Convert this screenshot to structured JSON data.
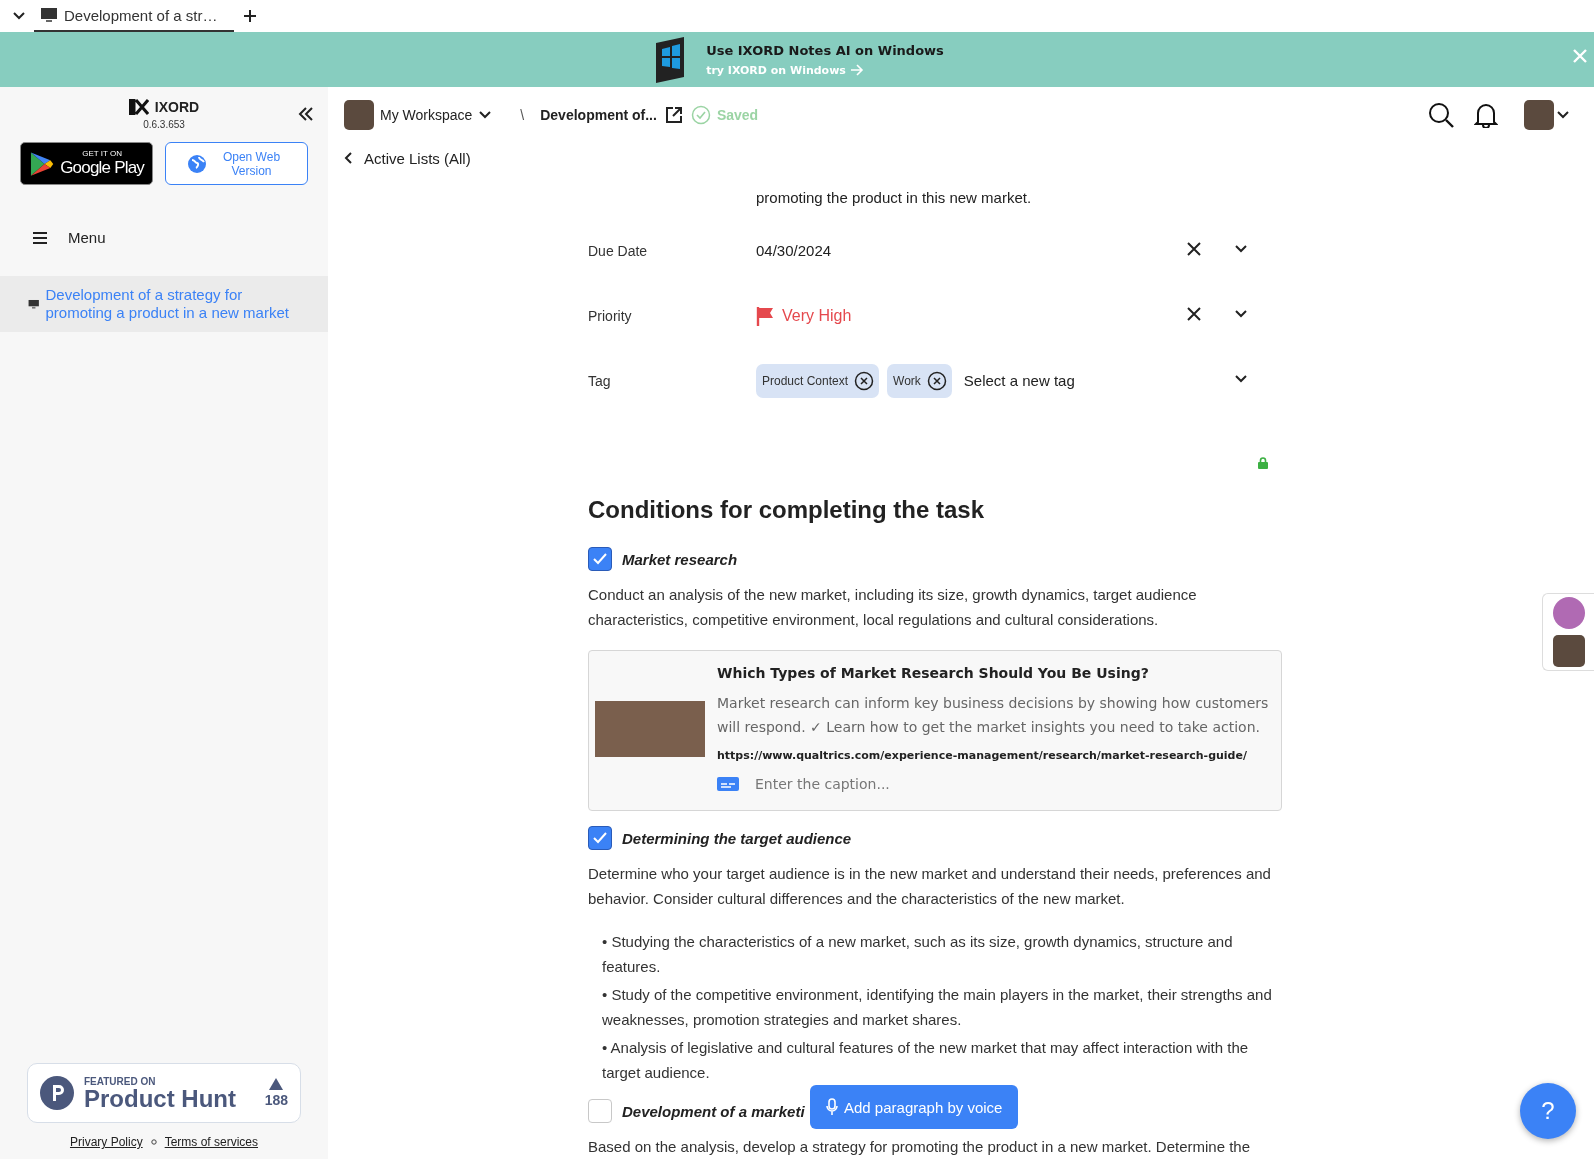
{
  "browser_tabs": [
    {
      "title": "Development of a str…",
      "selected": true
    }
  ],
  "banner": {
    "title": "Use IXORD Notes AI on Windows",
    "link": "try IXORD on Windows"
  },
  "sidebar": {
    "brand": "IXORD",
    "version": "0.6.3.653",
    "store_button": {
      "small": "GET IT ON",
      "big": "Google Play"
    },
    "web_button": "Open Web Version",
    "menu_label": "Menu",
    "documents": [
      {
        "title": "Development of a strategy for promoting a product in a new market",
        "selected": true
      }
    ],
    "product_hunt": {
      "featured": "FEATURED ON",
      "name": "Product Hunt",
      "votes": "188"
    },
    "footer_links": [
      "Privary Policy",
      "Terms of services"
    ]
  },
  "header": {
    "workspace": "My Workspace",
    "separator": "\\",
    "document_title": "Development of...",
    "status": "Saved"
  },
  "back_link": "Active Lists (All)",
  "description_tail": "promoting the product in this new market.",
  "fields": [
    {
      "kind": "date",
      "label": "Due Date",
      "value": "04/30/2024"
    },
    {
      "kind": "priority",
      "label": "Priority",
      "value": "Very High"
    },
    {
      "kind": "tags",
      "label": "Tag",
      "tags": [
        "Product Context",
        "Work"
      ],
      "placeholder": "Select a new tag"
    }
  ],
  "conditions_title": "Conditions for completing the task",
  "conditions": [
    {
      "title": "Market research",
      "checked": true,
      "body": "Conduct an analysis of the new market, including its size, growth dynamics, target audience characteristics, competitive environment, local regulations and cultural considerations.",
      "link_card": {
        "title": "Which Types of Market Research Should You Be Using?",
        "description": "Market research can inform key business decisions by showing how customers will respond. ✓ Learn how to get the market insights you need to take action.",
        "url": "https://www.qualtrics.com/experience-management/research/market-research-guide/",
        "caption_placeholder": "Enter the caption..."
      }
    },
    {
      "title": "Determining the target audience",
      "checked": true,
      "body": "Determine who your target audience is in the new market and understand their needs, preferences and behavior. Consider cultural differences and the characteristics of the new market.",
      "bullets": [
        "• Studying the characteristics of a new market, such as its size, growth dynamics, structure and features.",
        "• Study of the competitive environment, identifying the main players in the market, their strengths and weaknesses, promotion strategies and market shares.",
        "• Analysis of legislative and cultural features of the new market that may affect interaction with the target audience."
      ]
    },
    {
      "title": "Development of a marketi",
      "checked": false,
      "body": "Based on the analysis, develop a strategy for promoting the product in a new market. Determine the"
    }
  ],
  "voice_button": "Add paragraph by voice",
  "help_button": "?"
}
